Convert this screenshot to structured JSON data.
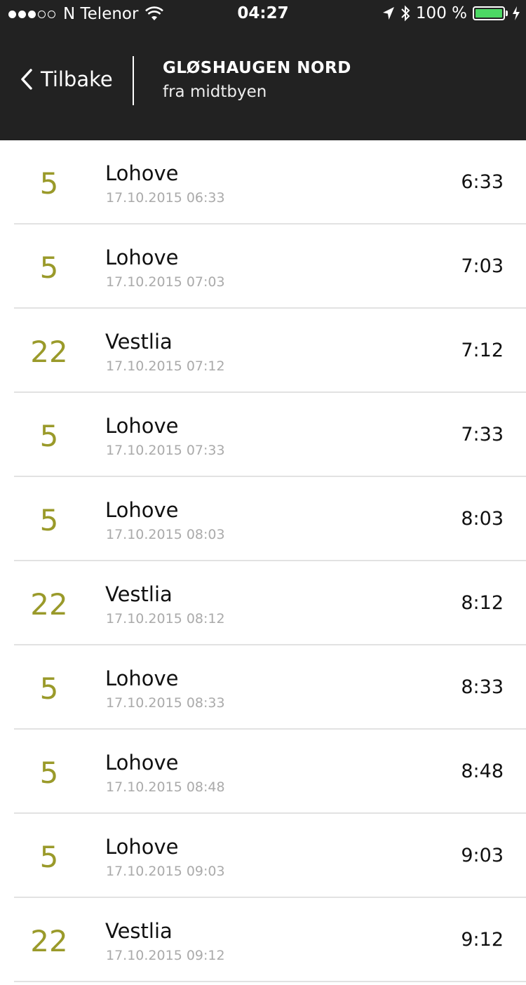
{
  "status": {
    "carrier": "N Telenor",
    "time": "04:27",
    "battery": "100 %",
    "battery_color": "#4cd964",
    "signal_bars_filled": 3,
    "signal_bars_total": 5
  },
  "nav": {
    "back_label": "Tilbake",
    "title": "GLØSHAUGEN NORD",
    "subtitle": "fra midtbyen"
  },
  "colors": {
    "route_color": "#9a9a2a",
    "bar_color": "#222222"
  },
  "departures": [
    {
      "route": "5",
      "destination": "Lohove",
      "date": "17.10.2015 06:33",
      "time": "6:33"
    },
    {
      "route": "5",
      "destination": "Lohove",
      "date": "17.10.2015 07:03",
      "time": "7:03"
    },
    {
      "route": "22",
      "destination": "Vestlia",
      "date": "17.10.2015 07:12",
      "time": "7:12"
    },
    {
      "route": "5",
      "destination": "Lohove",
      "date": "17.10.2015 07:33",
      "time": "7:33"
    },
    {
      "route": "5",
      "destination": "Lohove",
      "date": "17.10.2015 08:03",
      "time": "8:03"
    },
    {
      "route": "22",
      "destination": "Vestlia",
      "date": "17.10.2015 08:12",
      "time": "8:12"
    },
    {
      "route": "5",
      "destination": "Lohove",
      "date": "17.10.2015 08:33",
      "time": "8:33"
    },
    {
      "route": "5",
      "destination": "Lohove",
      "date": "17.10.2015 08:48",
      "time": "8:48"
    },
    {
      "route": "5",
      "destination": "Lohove",
      "date": "17.10.2015 09:03",
      "time": "9:03"
    },
    {
      "route": "22",
      "destination": "Vestlia",
      "date": "17.10.2015 09:12",
      "time": "9:12"
    }
  ]
}
